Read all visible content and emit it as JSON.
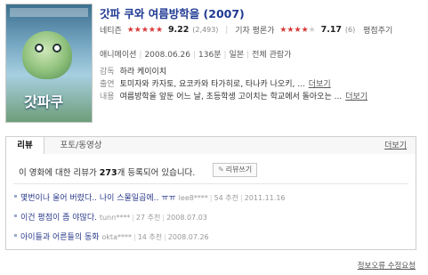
{
  "movie": {
    "title": "갓파 쿠와 여름방학을 (2007)"
  },
  "ratings": {
    "netizen_label": "네티즌",
    "netizen_stars": 4.6,
    "netizen_score": "9.22",
    "netizen_count": "(2,493)",
    "critic_label": "기자 평론가",
    "critic_stars": 3.6,
    "critic_score": "7.17",
    "critic_count": "(6)",
    "rank_label": "평점주기",
    "star_color": "#d93a3a"
  },
  "meta": {
    "genre": "애니메이션",
    "date": "2008.06.26",
    "runtime": "136분",
    "country": "일본",
    "rating": "전체 관람가"
  },
  "director": {
    "key": "감독",
    "value": "하라 케이이치"
  },
  "cast": {
    "key": "출연",
    "value": "토미자와 카자토, 요코카와 타가히로, 타나카 나오키, ...",
    "more": "더보기"
  },
  "plot": {
    "key": "내용",
    "value": "여름방학을 앞둔 어느 날, 초등학생 고이치는 학교에서 돌아오는 ...",
    "more": "더보기"
  },
  "tabs": {
    "review": "리뷰",
    "photo": "포토/동영상",
    "more": "더보기"
  },
  "reviews": {
    "summary_prefix": "이 영화에 대한 리뷰가 ",
    "summary_count": "273",
    "summary_suffix": "개 등록되어 있습니다.",
    "write_label": "리뷰쓰기",
    "items": [
      {
        "title": "몇번이나 울어 버렸다.. 나이 스물일곱에.. ㅠㅠ",
        "author": "lee8****",
        "recommend": "54 추천",
        "date": "2011.11.16"
      },
      {
        "title": "이건 평점이 좀 야많다.",
        "author": "tunn****",
        "recommend": "27 추천",
        "date": "2008.07.03"
      },
      {
        "title": "아이들과 어른들의 동화",
        "author": "okta****",
        "recommend": "14 추천",
        "date": "2008.07.26"
      }
    ]
  },
  "footer": {
    "link": "정보오류 수정요청"
  }
}
